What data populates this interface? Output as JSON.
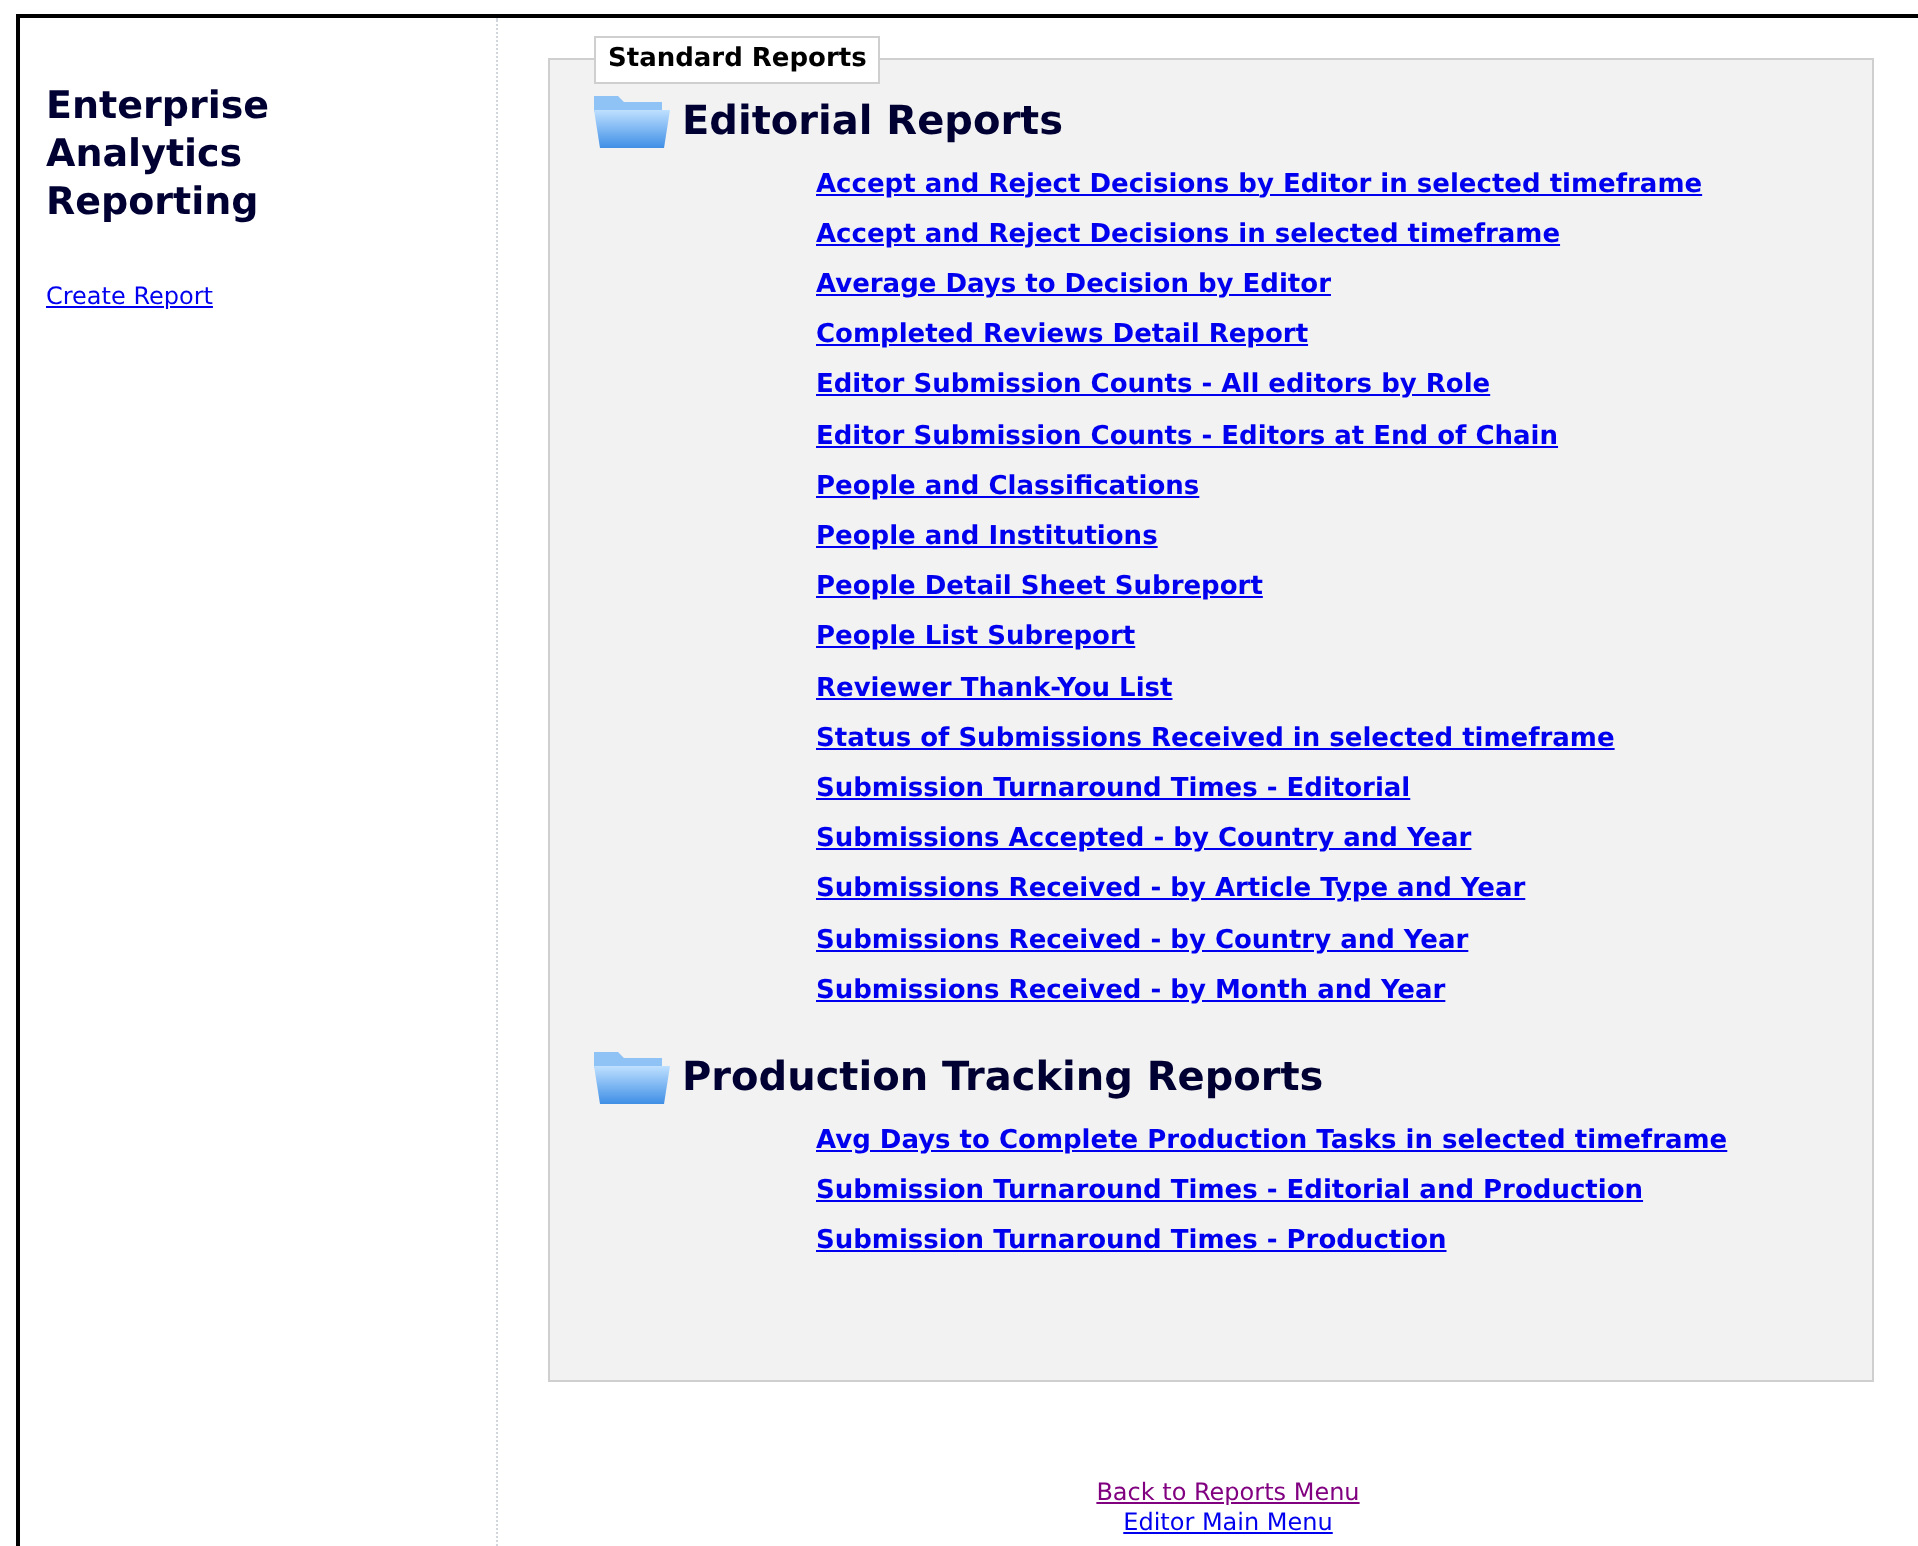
{
  "sidebar": {
    "title": "Enterprise Analytics Reporting",
    "links": [
      {
        "label": "Create Report"
      }
    ]
  },
  "standard_reports": {
    "legend": "Standard Reports",
    "sections": [
      {
        "heading": "Editorial Reports",
        "links": [
          "Accept and Reject Decisions by Editor in selected timeframe",
          "Accept and Reject Decisions in selected timeframe",
          "Average Days to Decision by Editor",
          "Completed Reviews Detail Report",
          "Editor Submission Counts - All editors by Role",
          "Editor Submission Counts - Editors at End of Chain",
          "People and Classifications",
          "People and Institutions",
          "People Detail Sheet Subreport",
          "People List Subreport",
          "Reviewer Thank-You List",
          "Status of Submissions Received in selected timeframe",
          "Submission Turnaround Times - Editorial",
          "Submissions Accepted - by Country and Year",
          "Submissions Received - by Article Type and Year",
          "Submissions Received - by Country and Year",
          "Submissions Received - by Month and Year"
        ]
      },
      {
        "heading": "Production Tracking Reports",
        "links": [
          "Avg Days to Complete Production Tasks in selected timeframe",
          "Submission Turnaround Times - Editorial and Production",
          "Submission Turnaround Times - Production"
        ]
      }
    ]
  },
  "footer_links": [
    {
      "label": "Back to Reports Menu",
      "visited": true
    },
    {
      "label": "Editor Main Menu",
      "visited": false
    }
  ]
}
